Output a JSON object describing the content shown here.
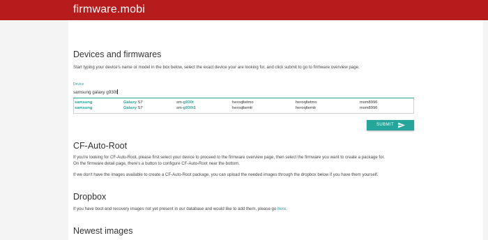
{
  "header": {
    "brand": "firmware.mobi"
  },
  "devices": {
    "title": "Devices and firmwares",
    "intro": "Start typing your device's name or model in the box below, select the exact device your are looking for, and click submit to go to firmware overview page.",
    "field_label": "Device",
    "field_value": "samsung galaxy g930t",
    "results": [
      {
        "brand": "samsung",
        "name_bold": "Galaxy",
        "name_rest": " S7",
        "model_prefix": "sm-",
        "model_bold": "g930t",
        "model_rest": "",
        "codename1": "heroqltetmo",
        "codename2": "heroqltetmo",
        "chipset": "msm8996"
      },
      {
        "brand": "samsung",
        "name_bold": "Galaxy",
        "name_rest": " S7",
        "model_prefix": "sm-",
        "model_bold": "g930t",
        "model_rest": "1",
        "codename1": "heroqltemtr",
        "codename2": "heroqltemtr",
        "chipset": "msm8996"
      }
    ],
    "submit_label": "SUBMIT"
  },
  "cfautoroot": {
    "title": "CF-Auto-Root",
    "para1_line1": "If you're looking for CF-Auto-Root, please first select your device to proceed to the firmware overview page, then select the firmware you want to create a package for.",
    "para1_line2": "On the firmware detail page, there's a button to configure CF-Auto-Root near the bottom.",
    "para2": "If we don't have the images available to create a CF-Auto-Root package, you can upload the needed images through the dropbox below if you have them yourself."
  },
  "dropbox": {
    "title": "Dropbox",
    "text": "If you have boot and recovery images not yet present in our database and would like to add them, please go ",
    "link": "here",
    "end": "."
  },
  "newest": {
    "title": "Newest images"
  },
  "colors": {
    "header": "#b71c1c",
    "accent": "#26a69a"
  }
}
